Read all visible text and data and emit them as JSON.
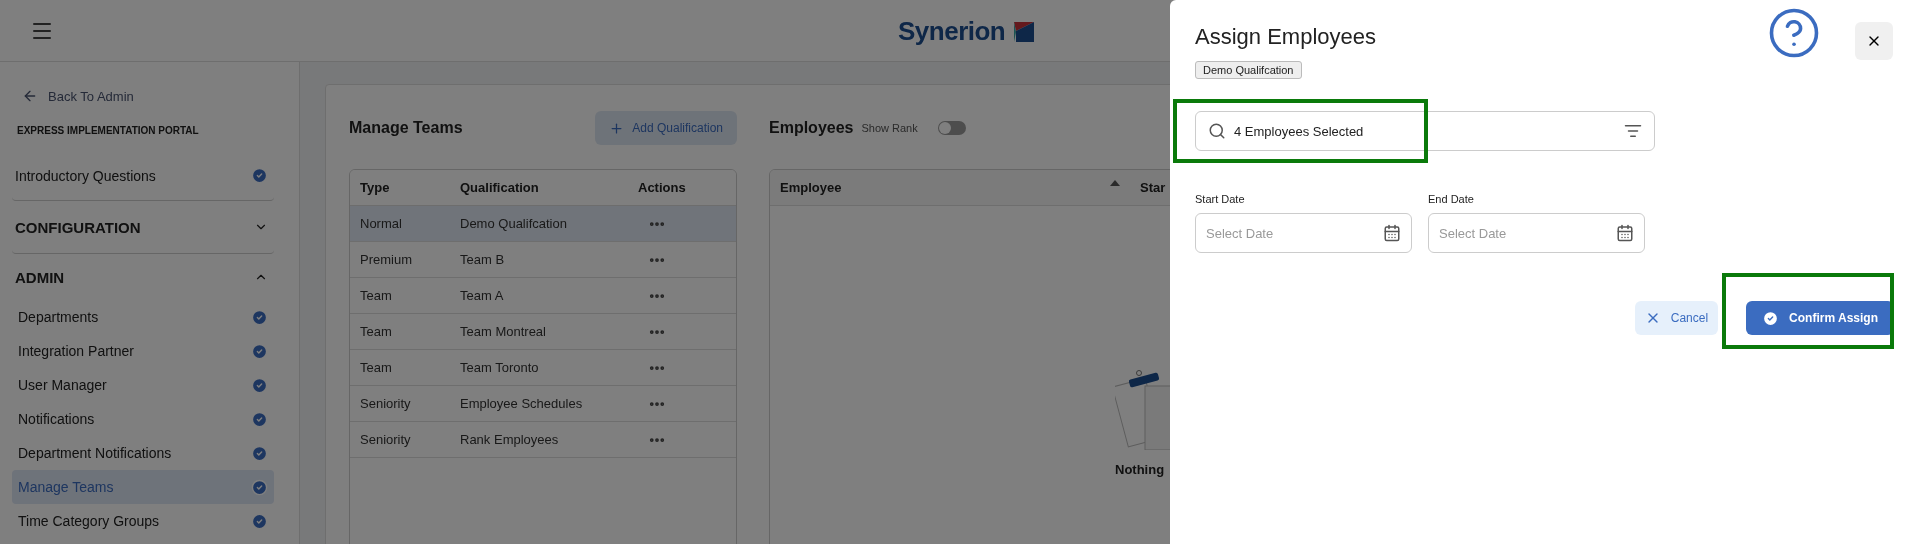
{
  "header": {
    "logo": "Synerion"
  },
  "sidebar": {
    "back_link": "Back To Admin",
    "portal_title": "EXPRESS IMPLEMENTATION PORTAL",
    "items": [
      {
        "kind": "link",
        "label": "Introductory Questions",
        "completed": true,
        "selected": false
      },
      {
        "kind": "section",
        "label": "CONFIGURATION",
        "expanded": false
      },
      {
        "kind": "section",
        "label": "ADMIN",
        "expanded": true,
        "children": [
          {
            "label": "Departments",
            "completed": true,
            "selected": false
          },
          {
            "label": "Integration Partner",
            "completed": true,
            "selected": false
          },
          {
            "label": "User Manager",
            "completed": true,
            "selected": false
          },
          {
            "label": "Notifications",
            "completed": true,
            "selected": false
          },
          {
            "label": "Department Notifications",
            "completed": true,
            "selected": false
          },
          {
            "label": "Manage Teams",
            "completed": true,
            "selected": true
          },
          {
            "label": "Time Category Groups",
            "completed": true,
            "selected": false
          }
        ]
      }
    ]
  },
  "teams": {
    "title": "Manage Teams",
    "add_button": "Add Qualification",
    "columns": [
      "Type",
      "Qualification",
      "Actions"
    ],
    "rows": [
      {
        "type": "Normal",
        "qualification": "Demo Qualifcation",
        "selected": true
      },
      {
        "type": "Premium",
        "qualification": "Team B",
        "selected": false
      },
      {
        "type": "Team",
        "qualification": "Team A",
        "selected": false
      },
      {
        "type": "Team",
        "qualification": "Team Montreal",
        "selected": false
      },
      {
        "type": "Team",
        "qualification": "Team Toronto",
        "selected": false
      },
      {
        "type": "Seniority",
        "qualification": "Employee Schedules",
        "selected": false
      },
      {
        "type": "Seniority",
        "qualification": "Rank Employees",
        "selected": false
      }
    ]
  },
  "employees": {
    "title": "Employees",
    "show_rank": {
      "label": "Show Rank",
      "on": false
    },
    "columns": [
      "Employee",
      "Star"
    ],
    "empty_text": "Nothing"
  },
  "drawer": {
    "title": "Assign Employees",
    "chip": "Demo Qualifcation",
    "search": {
      "value": "4 Employees Selected",
      "highlighted": true
    },
    "dates": [
      {
        "label": "Start Date",
        "placeholder": "Select Date"
      },
      {
        "label": "End Date",
        "placeholder": "Select Date"
      }
    ],
    "cancel_button": "Cancel",
    "confirm_button": {
      "label": "Confirm Assign",
      "highlighted": true
    }
  }
}
